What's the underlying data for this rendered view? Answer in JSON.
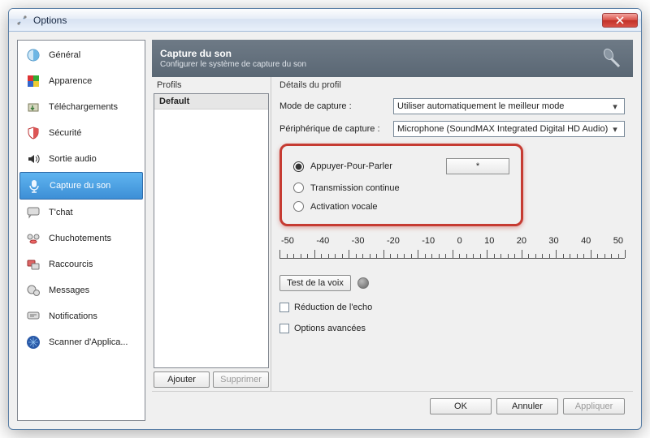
{
  "window": {
    "title": "Options"
  },
  "sidebar": {
    "items": [
      {
        "label": "Général"
      },
      {
        "label": "Apparence"
      },
      {
        "label": "Téléchargements"
      },
      {
        "label": "Sécurité"
      },
      {
        "label": "Sortie audio"
      },
      {
        "label": "Capture du son"
      },
      {
        "label": "T'chat"
      },
      {
        "label": "Chuchotements"
      },
      {
        "label": "Raccourcis"
      },
      {
        "label": "Messages"
      },
      {
        "label": "Notifications"
      },
      {
        "label": "Scanner d'Applica..."
      }
    ]
  },
  "banner": {
    "title": "Capture du son",
    "subtitle": "Configurer le système de capture du son"
  },
  "profils": {
    "header": "Profils",
    "items": [
      "Default"
    ],
    "add": "Ajouter",
    "remove": "Supprimer"
  },
  "details": {
    "header": "Détails du profil",
    "mode_label": "Mode de capture :",
    "mode_value": "Utiliser automatiquement le meilleur mode",
    "device_label": "Périphérique de capture :",
    "device_value": "Microphone (SoundMAX Integrated Digital HD Audio)",
    "radios": {
      "ptt": "Appuyer-Pour-Parler",
      "ptt_key": "*",
      "ct": "Transmission continue",
      "va": "Activation vocale"
    },
    "ruler": [
      "-50",
      "-40",
      "-30",
      "-20",
      "-10",
      "0",
      "10",
      "20",
      "30",
      "40",
      "50"
    ],
    "test": "Test de la voix",
    "echo": "Réduction de l'echo",
    "advanced": "Options avancées"
  },
  "footer": {
    "ok": "OK",
    "cancel": "Annuler",
    "apply": "Appliquer"
  }
}
